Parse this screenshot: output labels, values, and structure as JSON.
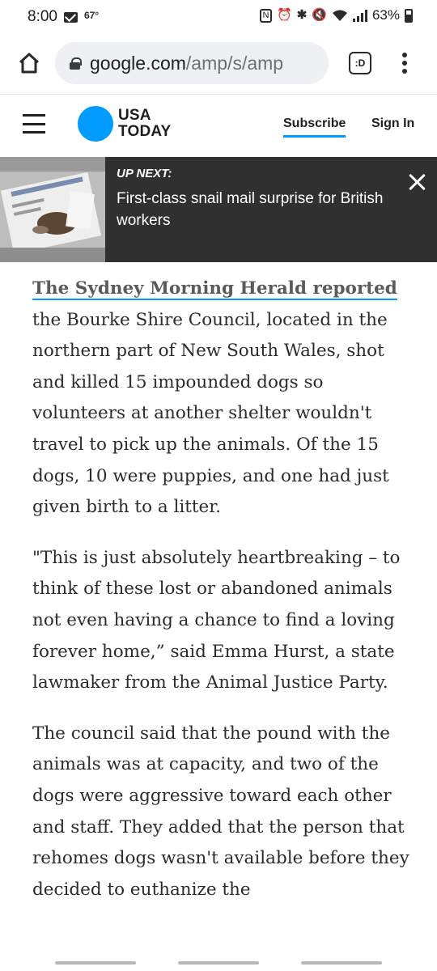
{
  "status_bar": {
    "time": "8:00",
    "temperature": "67°",
    "battery": "63%",
    "icons": [
      "mail-icon",
      "nfc-icon",
      "alarm-icon",
      "bluetooth-icon",
      "mute-icon",
      "wifi-icon",
      "signal-icon",
      "battery-icon"
    ]
  },
  "browser": {
    "url_domain": "google.com",
    "url_path": "/amp/s/amp",
    "tab_icon_text": ":D"
  },
  "site": {
    "logo_line1": "USA",
    "logo_line2": "TODAY",
    "brand_color": "#009bff",
    "subscribe": "Subscribe",
    "sign_in": "Sign In"
  },
  "up_next": {
    "label": "UP NEXT:",
    "title": "First-class snail mail surprise for British workers"
  },
  "article": {
    "p1_link": "The Sydney Morning Herald reported",
    "p1_text": " the Bourke Shire Council, located in the northern part of New South Wales, shot and killed 15 impounded dogs so volunteers at another shelter wouldn't travel to pick up the animals. Of the 15 dogs, 10 were puppies, and one had just given birth to a litter.",
    "p2": "\"This is just absolutely heartbreaking – to think of these lost or abandoned animals not even having a chance to find a loving forever home,” said Emma Hurst, a state lawmaker from the Animal Justice Party.",
    "p3": "The council said that the pound with the animals was at capacity, and two of the dogs were aggressive toward each other and staff. They added that the person that rehomes dogs wasn't available before they decided to euthanize the"
  }
}
